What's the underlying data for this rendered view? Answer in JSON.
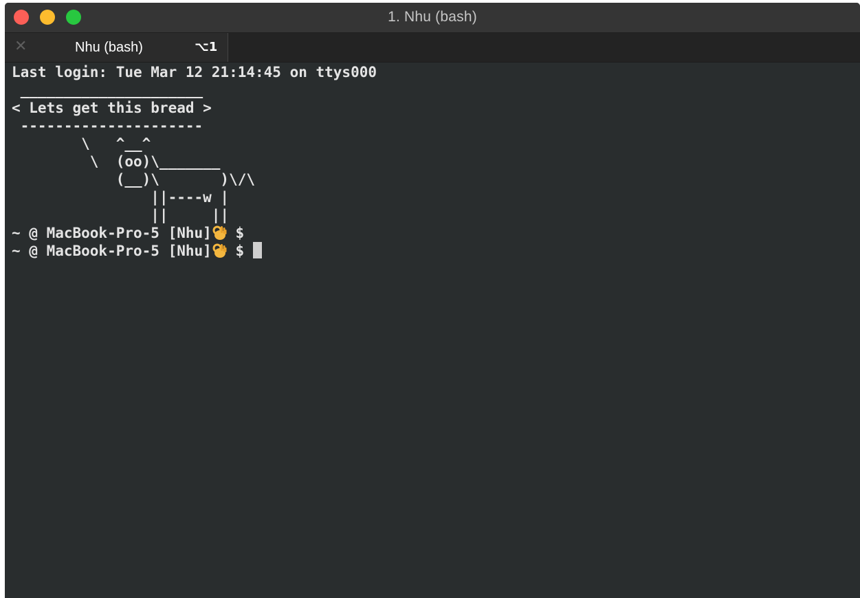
{
  "window": {
    "title": "1. Nhu (bash)"
  },
  "tabs": [
    {
      "close_glyph": "✕",
      "label": "Nhu (bash)",
      "shortcut": "⌥1"
    }
  ],
  "terminal": {
    "last_login": "Last login: Tue Mar 12 21:14:45 on ttys000",
    "cowsay": [
      " _____________________",
      "< Lets get this bread >",
      " ---------------------",
      "        \\   ^__^",
      "         \\  (oo)\\_______",
      "            (__)\\       )\\/\\",
      "                ||----w |",
      "                ||     ||"
    ],
    "prompt_text": "~ @ MacBook-Pro-5 [Nhu]",
    "prompt_icon": "ok-hand-icon",
    "prompt_symbol": " $",
    "prompt_count": 2
  },
  "colors": {
    "background": "#292d2e",
    "text": "#e4e4e4",
    "titlebar": "#353535",
    "close": "#fc5f57",
    "minimize": "#fdbc2e",
    "zoom": "#28c840"
  }
}
